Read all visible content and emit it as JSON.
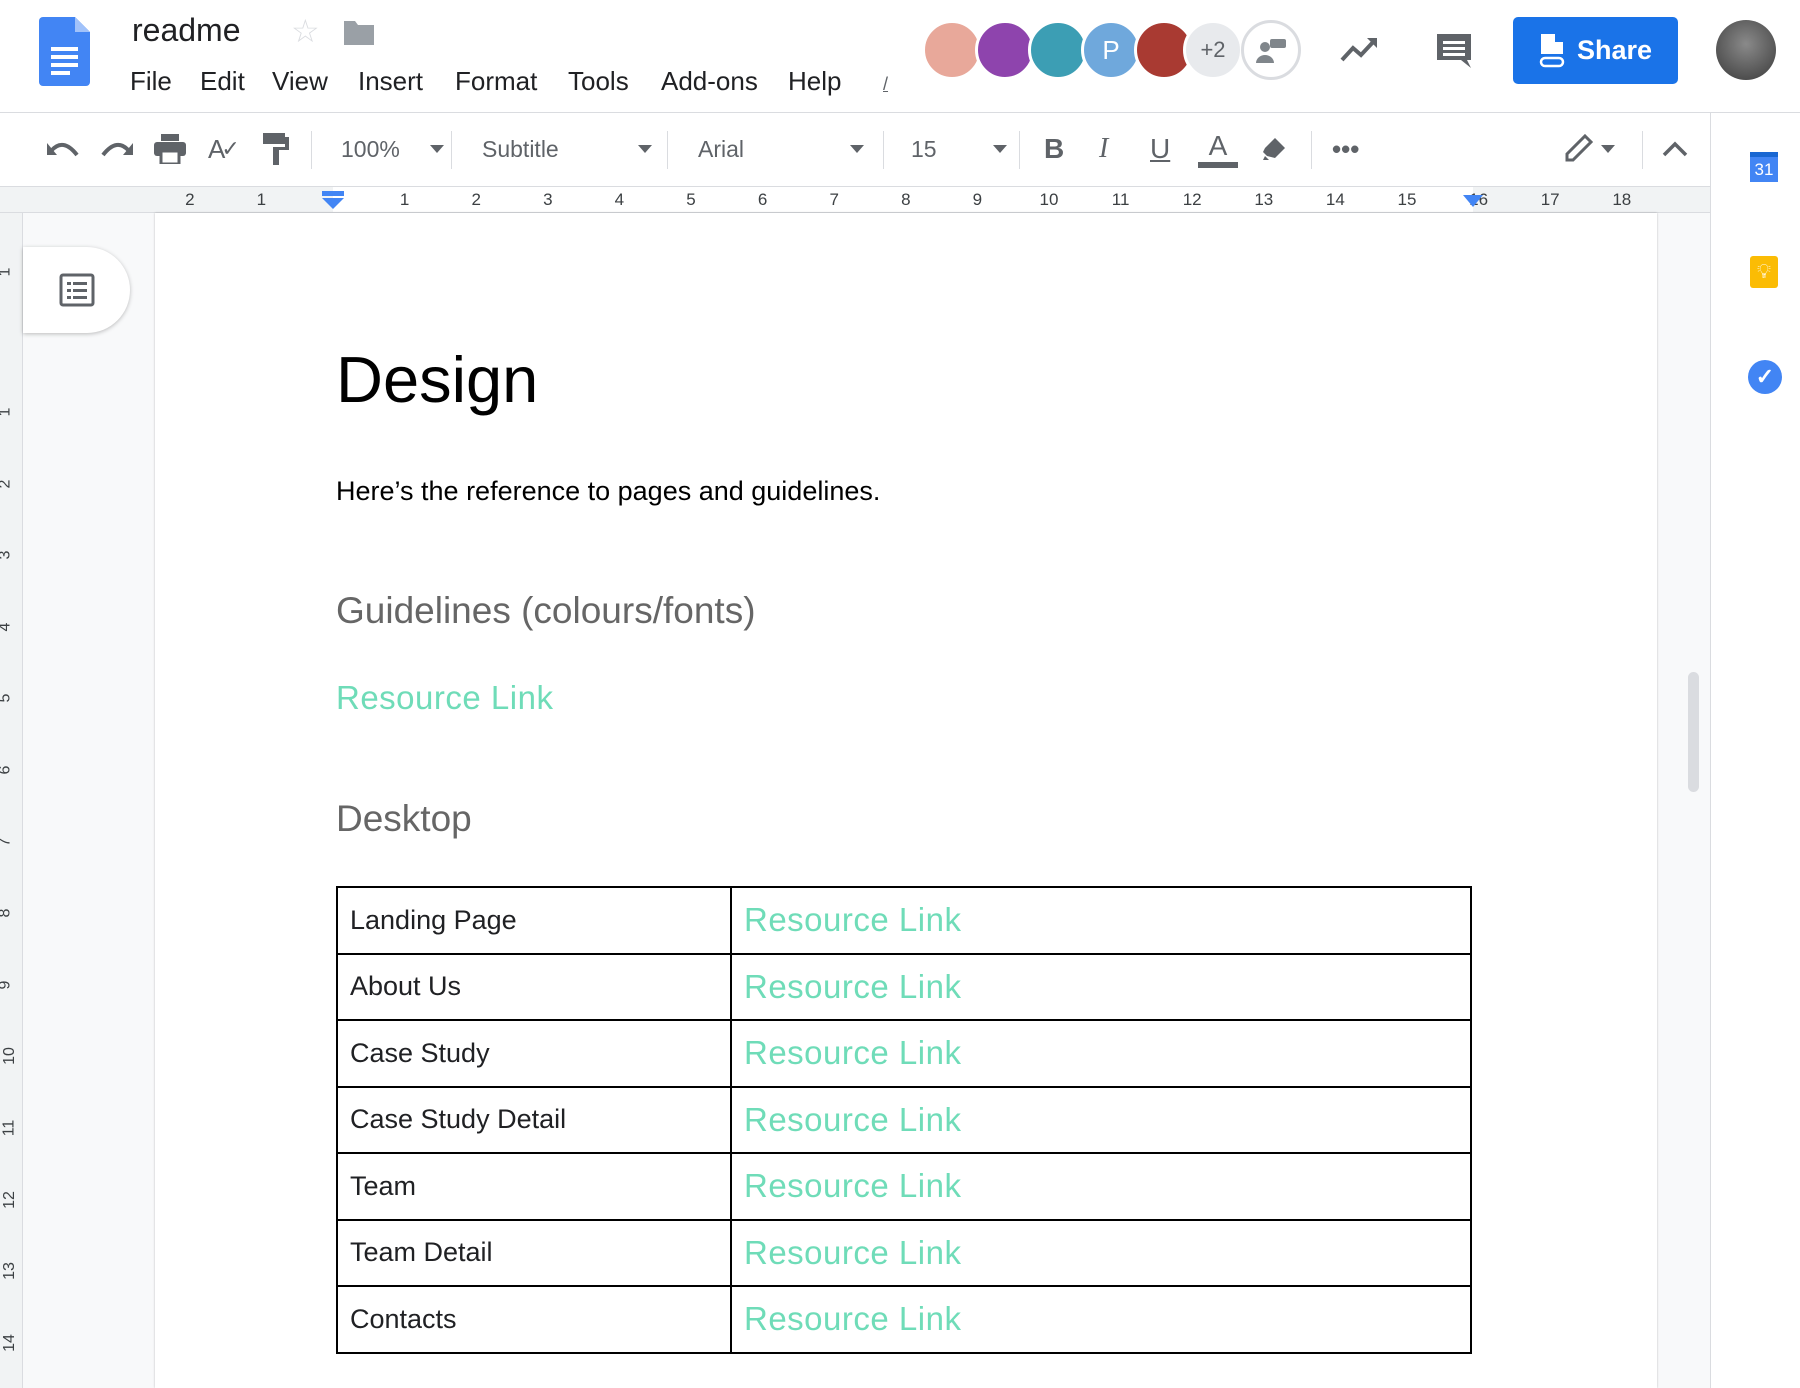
{
  "app": {
    "doc_title": "readme",
    "menu": [
      "File",
      "Edit",
      "View",
      "Insert",
      "Format",
      "Tools",
      "Add-ons",
      "Help"
    ],
    "last_edit_stub": "/"
  },
  "collaborators": {
    "avatars": [
      {
        "color": "#e8a89a",
        "initial": ""
      },
      {
        "color": "#8e44ad",
        "initial": ""
      },
      {
        "color": "#3c9eb4",
        "initial": ""
      },
      {
        "color": "#6fa8dc",
        "initial": "P"
      },
      {
        "color": "#a93a32",
        "initial": ""
      }
    ],
    "more_count": "+2"
  },
  "share": {
    "label": "Share",
    "color": "#1a73e8"
  },
  "toolbar": {
    "zoom": "100%",
    "style": "Subtitle",
    "font": "Arial",
    "size": "15"
  },
  "ruler": {
    "labels_left": [
      "2",
      "1"
    ],
    "labels_right": [
      "1",
      "2",
      "3",
      "4",
      "5",
      "6",
      "7",
      "8",
      "9",
      "10",
      "11",
      "12",
      "13",
      "14",
      "15",
      "16",
      "17",
      "18"
    ],
    "vertical": [
      "1",
      "1",
      "2",
      "3",
      "4",
      "5",
      "6",
      "7",
      "8",
      "9",
      "10",
      "11",
      "12",
      "13",
      "14"
    ]
  },
  "doc": {
    "title": "Design",
    "intro": "Here’s the reference to pages and guidelines.",
    "guidelines_heading": "Guidelines (colours/fonts)",
    "guidelines_link": "Resource Link",
    "desktop_heading": "Desktop",
    "link_color": "#6fdcb8",
    "table": [
      {
        "page": "Landing Page",
        "link": "Resource Link"
      },
      {
        "page": "About Us",
        "link": "Resource Link"
      },
      {
        "page": "Case Study",
        "link": "Resource Link"
      },
      {
        "page": "Case Study Detail",
        "link": "Resource Link"
      },
      {
        "page": "Team",
        "link": "Resource Link"
      },
      {
        "page": "Team Detail",
        "link": "Resource Link"
      },
      {
        "page": "Contacts",
        "link": "Resource Link"
      }
    ]
  },
  "side_panel": {
    "calendar_day": "31"
  }
}
